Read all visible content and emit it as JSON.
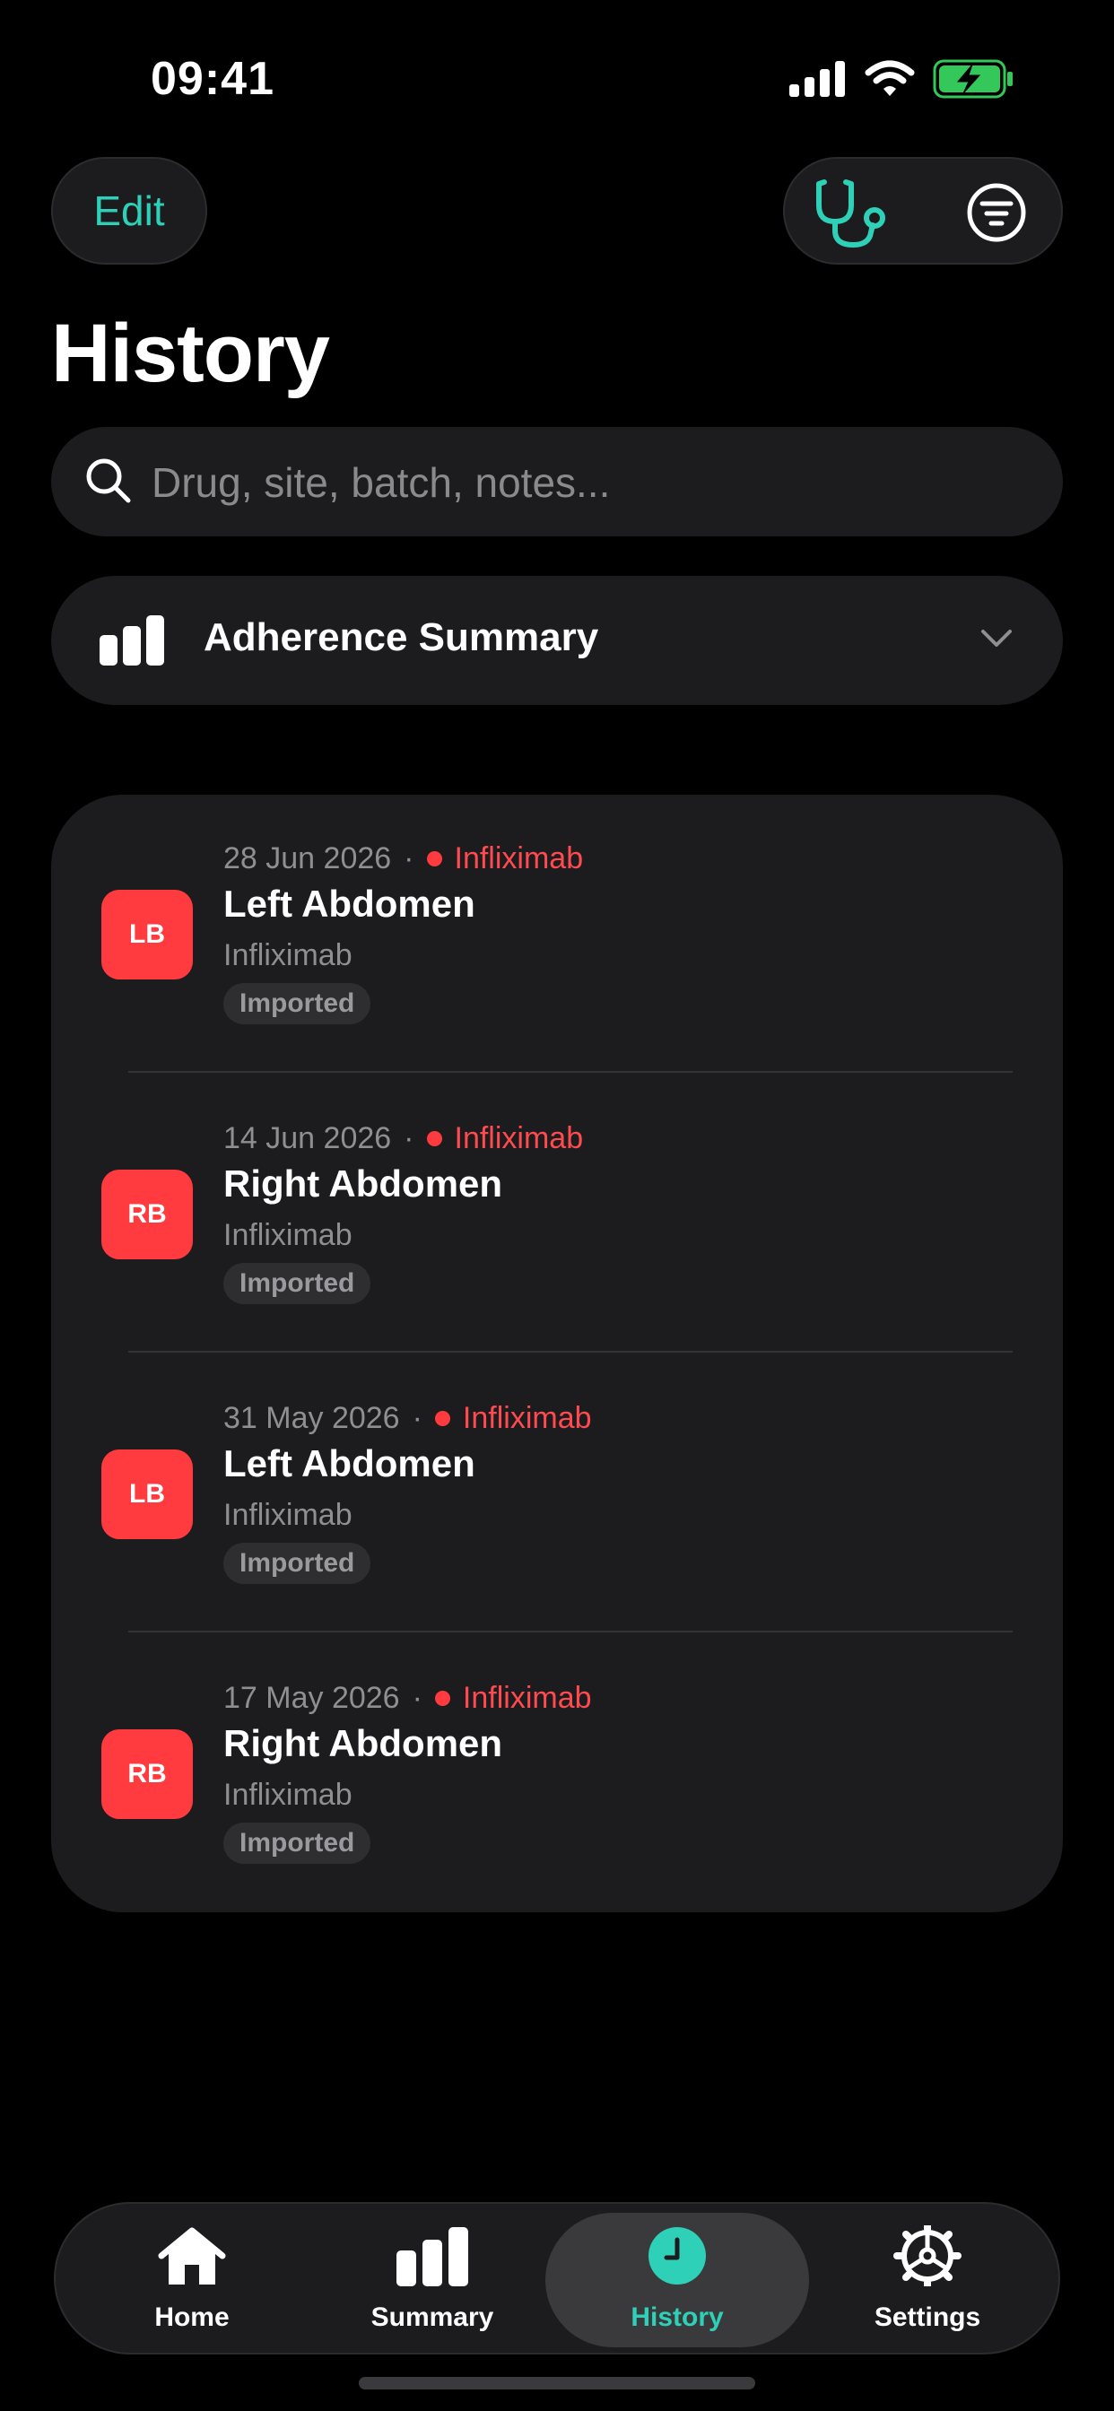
{
  "status_bar": {
    "time": "09:41"
  },
  "header": {
    "edit_label": "Edit",
    "title": "History"
  },
  "search": {
    "placeholder": "Drug, site, batch, notes..."
  },
  "adherence": {
    "label": "Adherence Summary"
  },
  "colors": {
    "accent": "#2ed1b8",
    "site_badge": "#ff3b3f",
    "background": "#000000",
    "card": "#1c1c1e"
  },
  "entries": [
    {
      "date": "28 Jun 2026",
      "drug": "Infliximab",
      "badge": "LB",
      "site": "Left Abdomen",
      "medication": "Infliximab",
      "tag": "Imported"
    },
    {
      "date": "14 Jun 2026",
      "drug": "Infliximab",
      "badge": "RB",
      "site": "Right Abdomen",
      "medication": "Infliximab",
      "tag": "Imported"
    },
    {
      "date": "31 May 2026",
      "drug": "Infliximab",
      "badge": "LB",
      "site": "Left Abdomen",
      "medication": "Infliximab",
      "tag": "Imported"
    },
    {
      "date": "17 May 2026",
      "drug": "Infliximab",
      "badge": "RB",
      "site": "Right Abdomen",
      "medication": "Infliximab",
      "tag": "Imported"
    }
  ],
  "meta_separator": "·",
  "tabs": [
    {
      "label": "Home",
      "icon": "house-icon"
    },
    {
      "label": "Summary",
      "icon": "bar-chart-icon"
    },
    {
      "label": "History",
      "icon": "clock-icon",
      "active": true
    },
    {
      "label": "Settings",
      "icon": "gear-icon"
    }
  ]
}
